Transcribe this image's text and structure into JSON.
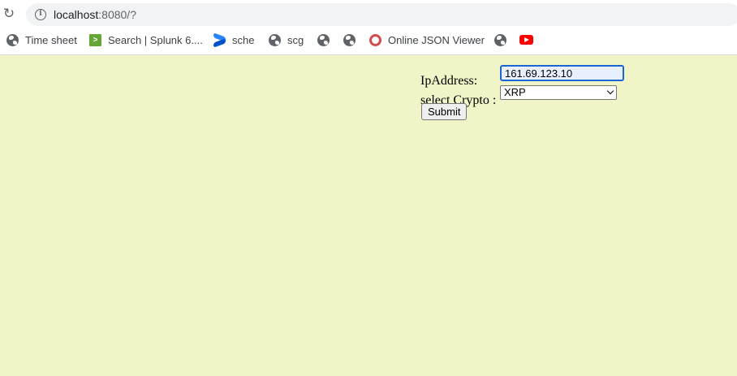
{
  "browser": {
    "url_host": "localhost",
    "url_rest": ":8080/?",
    "bookmarks": [
      {
        "label": "Time sheet",
        "icon": "globe-icon"
      },
      {
        "label": "Search | Splunk 6....",
        "icon": "splunk-icon"
      },
      {
        "label": "sche",
        "icon": "confluence-icon"
      },
      {
        "label": "scg",
        "icon": "globe-icon"
      },
      {
        "label": "",
        "icon": "globe-icon"
      },
      {
        "label": "",
        "icon": "globe-icon"
      },
      {
        "label": "Online JSON Viewer",
        "icon": "json-viewer-icon"
      },
      {
        "label": "",
        "icon": "globe-icon"
      },
      {
        "label": "",
        "icon": "youtube-icon"
      }
    ]
  },
  "form": {
    "ip_label": "IpAddress:",
    "ip_value": "161.69.123.10",
    "crypto_label": "select Crypto :",
    "crypto_selected": "XRP",
    "submit_label": "Submit"
  },
  "colors": {
    "page_background": "#f1f4c7",
    "focus_border": "#1a66d2"
  }
}
